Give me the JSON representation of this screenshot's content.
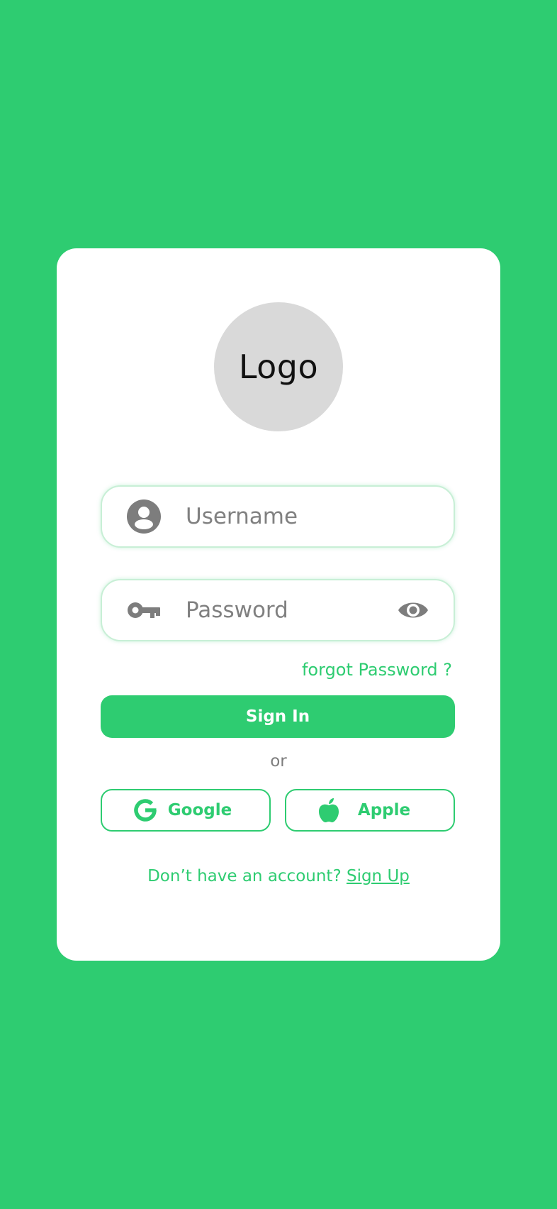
{
  "colors": {
    "background": "#2ECC71",
    "card": "#FFFFFF",
    "accent": "#2ECC71",
    "icon_gray": "#7D7D7D",
    "logo_circle": "#D9D9D9"
  },
  "logo": {
    "text": "Logo"
  },
  "username": {
    "placeholder": "Username",
    "icon": "user-circle-icon"
  },
  "password": {
    "placeholder": "Password",
    "icon": "key-icon",
    "toggle_icon": "eye-icon"
  },
  "forgot_password": "forgot Password ?",
  "sign_in_label": "Sign In",
  "divider_text": "or",
  "social": {
    "google_label": "Google",
    "google_icon": "google-icon",
    "apple_label": "Apple",
    "apple_icon": "apple-icon"
  },
  "signup": {
    "prompt": "Don’t have an account? ",
    "link": "Sign Up"
  }
}
